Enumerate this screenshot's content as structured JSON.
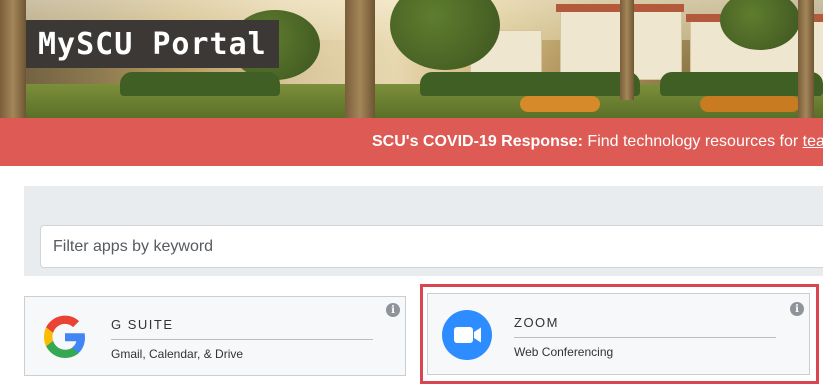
{
  "header": {
    "brand": "MySCU Portal"
  },
  "banner": {
    "label": "SCU's COVID-19 Response:",
    "text": " Find technology resources for ",
    "link": "teaching"
  },
  "filter": {
    "placeholder": "Filter apps by keyword"
  },
  "apps": [
    {
      "title": "G SUITE",
      "description": "Gmail, Calendar, & Drive",
      "icon": "google-g-icon"
    },
    {
      "title": "ZOOM",
      "description": "Web Conferencing",
      "icon": "zoom-camera-icon"
    }
  ],
  "colors": {
    "banner": "#dd5b54",
    "highlight": "#d9464f",
    "zoom_blue": "#2d8cff"
  }
}
